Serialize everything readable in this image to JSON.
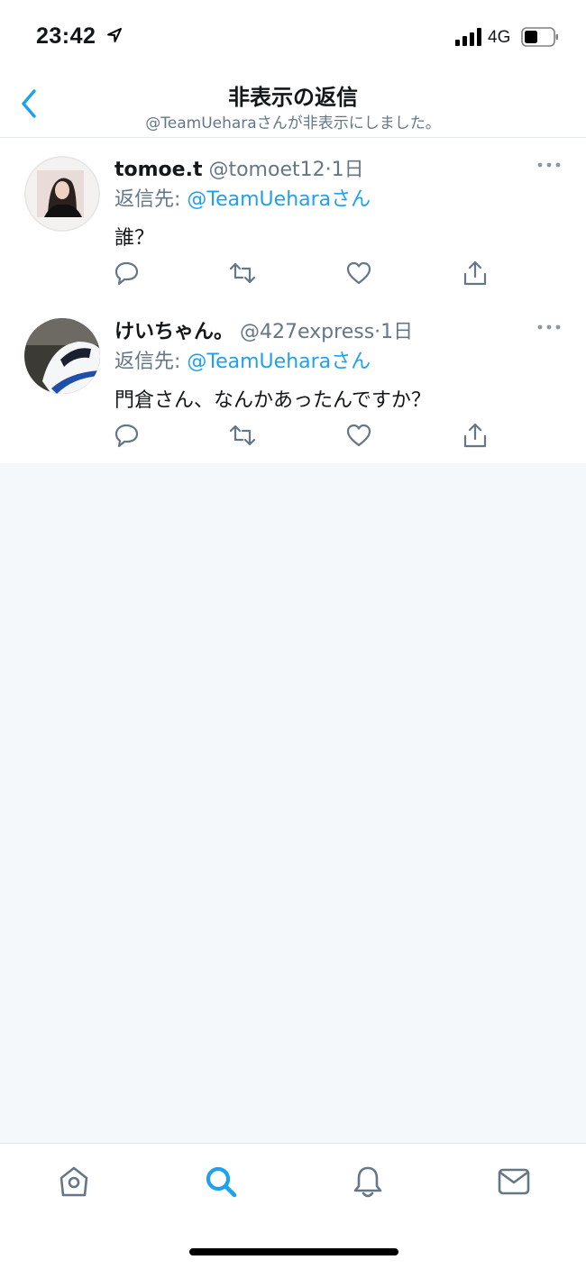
{
  "status_bar": {
    "time": "23:42",
    "network": "4G"
  },
  "nav": {
    "title": "非表示の返信",
    "subtitle": "@TeamUeharaさんが非表示にしました。"
  },
  "tweets": [
    {
      "name": "tomoe.t",
      "handle": "@tomoet12",
      "age": "1日",
      "reply_prefix": "返信先: ",
      "reply_mention": "@TeamUeharaさん",
      "text": "誰？"
    },
    {
      "name": "けいちゃん。",
      "handle": "@427express",
      "age": "1日",
      "reply_prefix": "返信先: ",
      "reply_mention": "@TeamUeharaさん",
      "text": "門倉さん、なんかあったんですか？"
    }
  ],
  "tabs": [
    "home-icon",
    "search-icon",
    "notifications-icon",
    "messages-icon"
  ],
  "colors": {
    "accent": "#1da1f2",
    "secondary_text": "#657786",
    "divider": "#e1e8ed",
    "empty_bg": "#f5f8fa"
  }
}
